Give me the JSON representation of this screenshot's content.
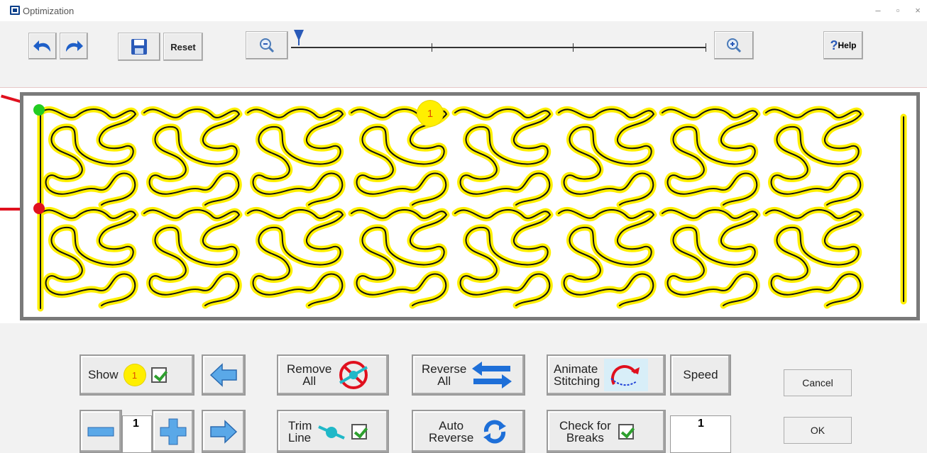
{
  "window": {
    "title": "Optimization",
    "controls": [
      "–",
      "▫",
      "×"
    ]
  },
  "toolbar": {
    "reset_label": "Reset",
    "help_label": "Help",
    "help_glyph": "?"
  },
  "canvas": {
    "segment_badge": "1",
    "pattern_color": "#ffef00",
    "start_color": "#22cc22",
    "end_color": "#e0101e"
  },
  "controls": {
    "show_label": "Show",
    "show_badge": "1",
    "remove_all_line1": "Remove",
    "remove_all_line2": "All",
    "reverse_all_line1": "Reverse",
    "reverse_all_line2": "All",
    "animate_line1": "Animate",
    "animate_line2": "Stitching",
    "speed_label": "Speed",
    "cancel_label": "Cancel",
    "segment_value": "1",
    "trim_line1": "Trim",
    "trim_line2": "Line",
    "auto_reverse_line1": "Auto",
    "auto_reverse_line2": "Reverse",
    "check_breaks_line1": "Check for",
    "check_breaks_line2": "Breaks",
    "speed_value": "1",
    "ok_label": "OK"
  }
}
